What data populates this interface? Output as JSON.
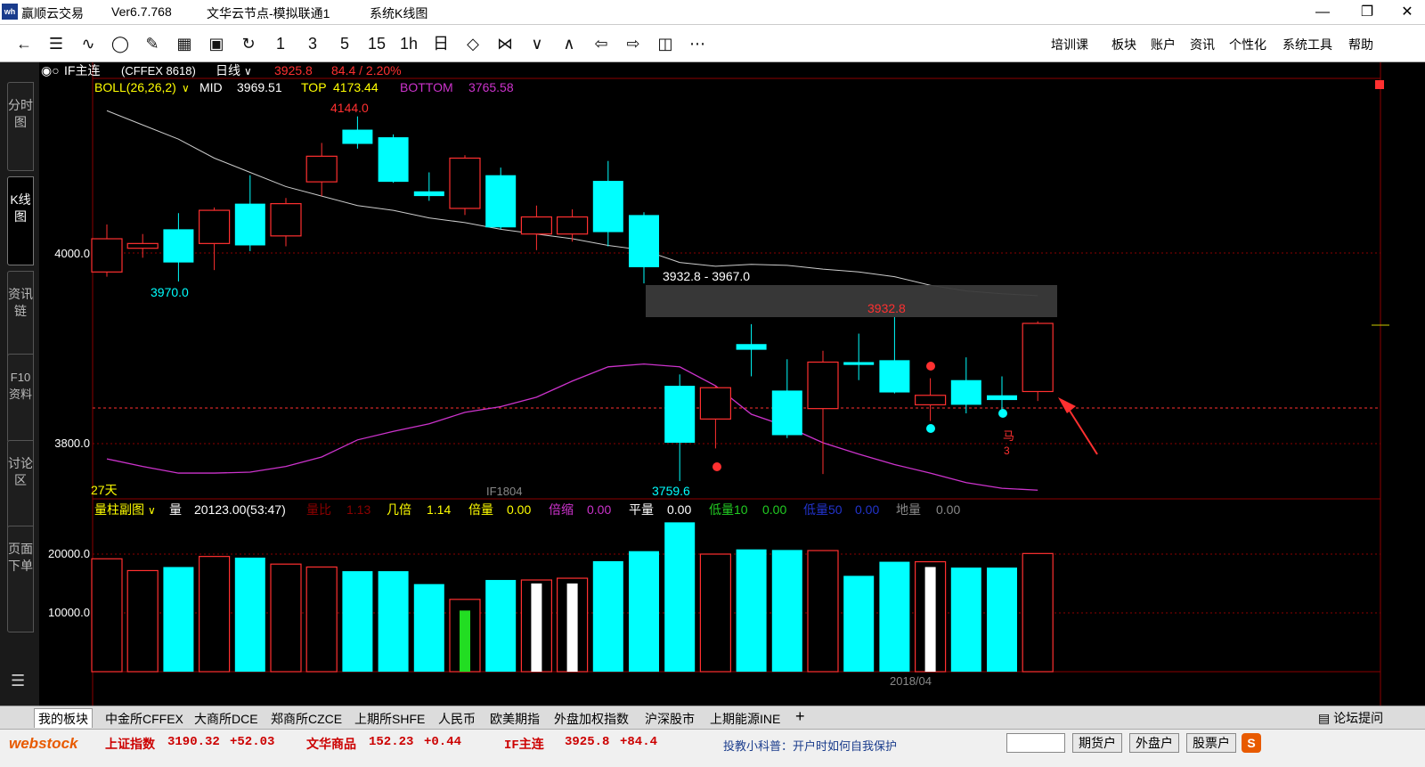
{
  "titlebar": {
    "app_name": "赢顺云交易",
    "version": "Ver6.7.768",
    "node": "文华云节点-模拟联通1",
    "view": "系统K线图",
    "logo_text": "wh"
  },
  "toolbar": {
    "periods": [
      "1",
      "3",
      "5",
      "15",
      "1h",
      "日"
    ],
    "menu": [
      "培训课",
      "板块",
      "账户",
      "资讯",
      "个性化",
      "系统工具",
      "帮助"
    ]
  },
  "sidebar": {
    "tabs": [
      "分时图",
      "K线图",
      "资讯链",
      "F10资料",
      "讨论区",
      "页面下单"
    ]
  },
  "chart": {
    "symbol": "IF主连",
    "exchange_code": "(CFFEX 8618)",
    "period": "日线",
    "price": "3925.8",
    "change": "84.4 / 2.20%",
    "boll_label": "BOLL(26,26,2)",
    "mid_label": "MID",
    "mid_value": "3969.51",
    "top_label": "TOP",
    "top_value": "4173.44",
    "bottom_label": "BOTTOM",
    "bottom_value": "3765.58",
    "days_label": "27天",
    "contract_label": "IF1804",
    "date_label": "2018/04",
    "high_label": "4144.0",
    "low_label_1": "3970.0",
    "low_label_2": "3759.6",
    "gap_label": "3932.8 - 3967.0",
    "gap_top_label": "3932.8",
    "marker_text": "马",
    "marker_num": "3",
    "price_ticks": [
      "4000.0",
      "3800.0"
    ],
    "vol_ticks": [
      "20000.0",
      "10000.0"
    ],
    "colors": {
      "up": "#ff3030",
      "down": "#00ffff",
      "mid": "#cccccc",
      "bottom": "#cc33cc"
    }
  },
  "volume_panel": {
    "title": "量柱副图",
    "vol_label": "量",
    "vol_value": "20123.00(53:47)",
    "ratio_label": "量比",
    "ratio_value": "1.13",
    "jibei_label": "几倍",
    "jibei_value": "1.14",
    "beiliang_label": "倍量",
    "beiliang_value": "0.00",
    "beisuo_label": "倍缩",
    "beisuo_value": "0.00",
    "pingliang_label": "平量",
    "pingliang_value": "0.00",
    "diliang10_label": "低量10",
    "diliang10_value": "0.00",
    "diliang50_label": "低量50",
    "diliang50_value": "0.00",
    "diliang_label": "地量",
    "diliang_value": "0.00"
  },
  "chart_data": {
    "type": "candlestick",
    "candles": [
      {
        "o": 3980,
        "c": 4015,
        "h": 4030,
        "l": 3975,
        "up": true
      },
      {
        "o": 4005,
        "c": 4010,
        "h": 4020,
        "l": 3995,
        "up": true
      },
      {
        "o": 4025,
        "c": 3990,
        "h": 4042,
        "l": 3970,
        "up": false
      },
      {
        "o": 4010,
        "c": 4045,
        "h": 4048,
        "l": 3982,
        "up": true
      },
      {
        "o": 4052,
        "c": 4008,
        "h": 4082,
        "l": 4002,
        "up": false
      },
      {
        "o": 4018,
        "c": 4052,
        "h": 4058,
        "l": 4007,
        "up": true
      },
      {
        "o": 4075,
        "c": 4102,
        "h": 4116,
        "l": 4060,
        "up": true
      },
      {
        "o": 4130,
        "c": 4115,
        "h": 4144,
        "l": 4110,
        "up": false
      },
      {
        "o": 4122,
        "c": 4075,
        "h": 4125,
        "l": 4074,
        "up": false
      },
      {
        "o": 4065,
        "c": 4060,
        "h": 4085,
        "l": 4055,
        "up": false
      },
      {
        "o": 4047,
        "c": 4100,
        "h": 4103,
        "l": 4040,
        "up": true
      },
      {
        "o": 4082,
        "c": 4027,
        "h": 4090,
        "l": 4025,
        "up": false
      },
      {
        "o": 4020,
        "c": 4038,
        "h": 4050,
        "l": 4003,
        "up": true
      },
      {
        "o": 4020,
        "c": 4038,
        "h": 4046,
        "l": 4012,
        "up": true
      },
      {
        "o": 4076,
        "c": 4022,
        "h": 4097,
        "l": 4007,
        "up": false
      },
      {
        "o": 4040,
        "c": 3985,
        "h": 4043,
        "l": 3968,
        "up": false
      },
      {
        "o": 3860,
        "c": 3800,
        "h": 3872,
        "l": 3759.6,
        "up": false
      },
      {
        "o": 3825,
        "c": 3858,
        "h": 3860,
        "l": 3794,
        "up": true
      },
      {
        "o": 3904,
        "c": 3898,
        "h": 3925,
        "l": 3870,
        "up": false
      },
      {
        "o": 3855,
        "c": 3808,
        "h": 3888,
        "l": 3805,
        "up": false
      },
      {
        "o": 3836,
        "c": 3885,
        "h": 3897,
        "l": 3767,
        "up": true
      },
      {
        "o": 3885,
        "c": 3882,
        "h": 3915,
        "l": 3866,
        "up": false
      },
      {
        "o": 3887,
        "c": 3853,
        "h": 3932.8,
        "l": 3852,
        "up": false
      },
      {
        "o": 3840,
        "c": 3850,
        "h": 3868,
        "l": 3823,
        "up": true
      },
      {
        "o": 3866,
        "c": 3840,
        "h": 3890,
        "l": 3831,
        "up": false
      },
      {
        "o": 3850,
        "c": 3845,
        "h": 3870,
        "l": 3835,
        "up": false
      },
      {
        "o": 3854,
        "c": 3925.8,
        "h": 3928,
        "l": 3844,
        "up": true
      }
    ],
    "mid": [
      4150,
      4135,
      4120,
      4100,
      4085,
      4070,
      4060,
      4050,
      4045,
      4037,
      4032,
      4025,
      4020,
      4015,
      4008,
      4003,
      3990,
      3986,
      3988,
      3987,
      3983,
      3980,
      3975,
      3966,
      3960,
      3957,
      3955
    ],
    "bottom": [
      3783,
      3775,
      3768,
      3768,
      3769,
      3775,
      3785,
      3803,
      3812,
      3820,
      3832,
      3838,
      3848,
      3865,
      3880,
      3883,
      3880,
      3860,
      3830,
      3817,
      3800,
      3788,
      3777,
      3768,
      3758,
      3752,
      3750
    ],
    "volumes": [
      19200,
      17200,
      17800,
      19600,
      19400,
      18300,
      17800,
      17100,
      17100,
      14900,
      12300,
      15600,
      15600,
      15900,
      18800,
      20500,
      25400,
      20000,
      20800,
      20700,
      20600,
      16300,
      18700,
      18700,
      17700,
      17700,
      20100
    ],
    "vol_style": [
      "r",
      "r",
      "c",
      "r",
      "c",
      "r",
      "r",
      "c",
      "c",
      "c",
      "r",
      "c",
      "r",
      "r",
      "c",
      "c",
      "c",
      "r",
      "c",
      "c",
      "r",
      "c",
      "c",
      "r",
      "c",
      "c",
      "r"
    ],
    "vol_inner": [
      0,
      0,
      0,
      0,
      0,
      0,
      0,
      0,
      0,
      0,
      10400,
      0,
      15000,
      15000,
      0,
      0,
      0,
      0,
      0,
      0,
      0,
      0,
      0,
      17800,
      0,
      0,
      0
    ]
  },
  "bottom_tabs": [
    "我的板块",
    "中金所CFFEX",
    "大商所DCE",
    "郑商所CZCE",
    "上期所SHFE",
    "人民币",
    "欧美期指",
    "外盘加权指数",
    "沪深股市",
    "上期能源INE"
  ],
  "ticker": {
    "brand_a": "web",
    "brand_b": "stock",
    "items": [
      {
        "name": "上证指数",
        "price": "3190.32",
        "chg": "+52.03"
      },
      {
        "name": "文华商品",
        "price": "152.23",
        "chg": "+0.44"
      },
      {
        "name": "IF主连",
        "price": "3925.8",
        "chg": "+84.4"
      }
    ],
    "news": "投教小科普：开户时如何自我保护",
    "buttons": [
      "期货户",
      "外盘户",
      "股票户"
    ],
    "forum": "论坛提问"
  }
}
